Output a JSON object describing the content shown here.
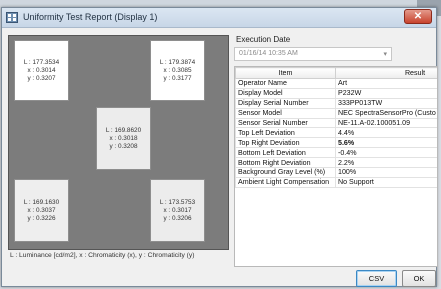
{
  "window": {
    "title": "Uniformity Test Report (Display 1)",
    "close_label": "✕"
  },
  "grid": {
    "top_left": {
      "l": "L : 177.3534",
      "x": "x : 0.3014",
      "y": "y : 0.3207"
    },
    "top_right": {
      "l": "L : 179.3874",
      "x": "x : 0.3085",
      "y": "y : 0.3177"
    },
    "center": {
      "l": "L : 169.8620",
      "x": "x : 0.3018",
      "y": "y : 0.3208"
    },
    "bottom_left": {
      "l": "L : 169.1630",
      "x": "x : 0.3037",
      "y": "y : 0.3226"
    },
    "bottom_right": {
      "l": "L : 173.5753",
      "x": "x : 0.3017",
      "y": "y : 0.3206"
    },
    "legend": "L : Luminance [cd/m2], x : Chromaticity (x), y : Chromaticity (y)"
  },
  "execution": {
    "label": "Execution Date",
    "selected": "01/16/14 10:35 AM"
  },
  "table": {
    "headers": {
      "item": "Item",
      "result": "Result"
    },
    "rows": [
      {
        "item": "Operator Name",
        "result": "Art"
      },
      {
        "item": "Display Model",
        "result": "P232W"
      },
      {
        "item": "Display Serial Number",
        "result": "333PP013TW"
      },
      {
        "item": "Sensor Model",
        "result": "NEC SpectraSensorPro (Custo"
      },
      {
        "item": "Sensor Serial Number",
        "result": "NE-11.A-02.100051.09"
      },
      {
        "item": "Top Left Deviation",
        "result": "4.4%"
      },
      {
        "item": "Top Right Deviation",
        "result": "5.6%"
      },
      {
        "item": "Bottom Left Deviation",
        "result": "-0.4%"
      },
      {
        "item": "Bottom Right Deviation",
        "result": "2.2%"
      },
      {
        "item": "Background Gray Level (%)",
        "result": "100%"
      },
      {
        "item": "Ambient Light Compensation",
        "result": "No Support"
      }
    ]
  },
  "buttons": {
    "csv_export": "CSV Export",
    "ok": "OK"
  },
  "colors": {
    "grid_background": "#7c7c7c",
    "titlebar": "#c7d6e7",
    "close_button": "#c8432d"
  }
}
